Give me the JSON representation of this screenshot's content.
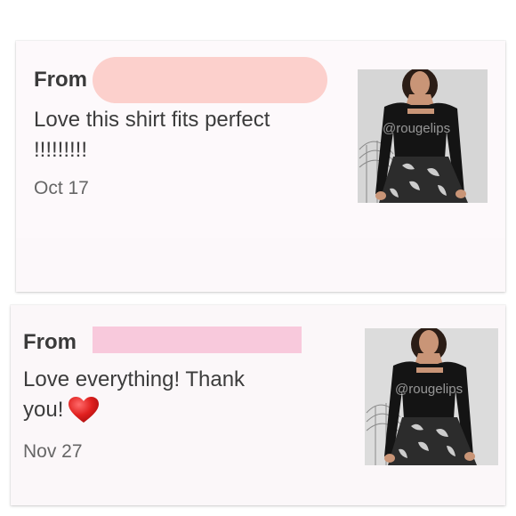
{
  "reviews": [
    {
      "from_label": "From",
      "text_line1": "Love this shirt fits perfect",
      "text_line2": "!!!!!!!!!",
      "date": "Oct 17",
      "watermark": "@rougelips",
      "redaction_color": "#fcd0cc"
    },
    {
      "from_label": "From",
      "text_line1": "Love everything! Thank",
      "text_line2": "you!",
      "date": "Nov 27",
      "watermark": "@rougelips",
      "heart_icon": "red-heart-icon",
      "redaction_color": "#f8c9dc"
    }
  ]
}
